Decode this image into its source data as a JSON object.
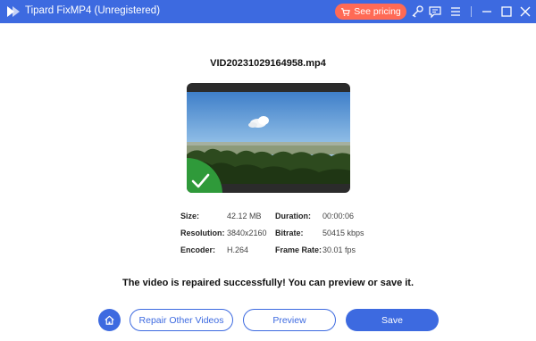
{
  "window": {
    "title": "Tipard FixMP4 (Unregistered)",
    "pricing_label": "See pricing",
    "accent_color": "#3d6ae0",
    "pricing_color": "#ff6a55"
  },
  "file": {
    "name": "VID20231029164958.mp4"
  },
  "info": {
    "size_label": "Size:",
    "size_value": "42.12 MB",
    "resolution_label": "Resolution:",
    "resolution_value": "3840x2160",
    "encoder_label": "Encoder:",
    "encoder_value": "H.264",
    "duration_label": "Duration:",
    "duration_value": "00:00:06",
    "bitrate_label": "Bitrate:",
    "bitrate_value": "50415 kbps",
    "framerate_label": "Frame Rate:",
    "framerate_value": "30.01 fps"
  },
  "status": {
    "message": "The video is repaired successfully! You can preview or save it."
  },
  "actions": {
    "repair_other_label": "Repair Other Videos",
    "preview_label": "Preview",
    "save_label": "Save"
  },
  "icons": {
    "logo": "play-logo-icon",
    "cart": "cart-icon",
    "key": "key-icon",
    "feedback": "feedback-icon",
    "menu": "menu-icon",
    "minimize": "minimize-icon",
    "maximize": "maximize-icon",
    "close": "close-icon",
    "home": "home-icon",
    "success": "checkmark-icon"
  }
}
